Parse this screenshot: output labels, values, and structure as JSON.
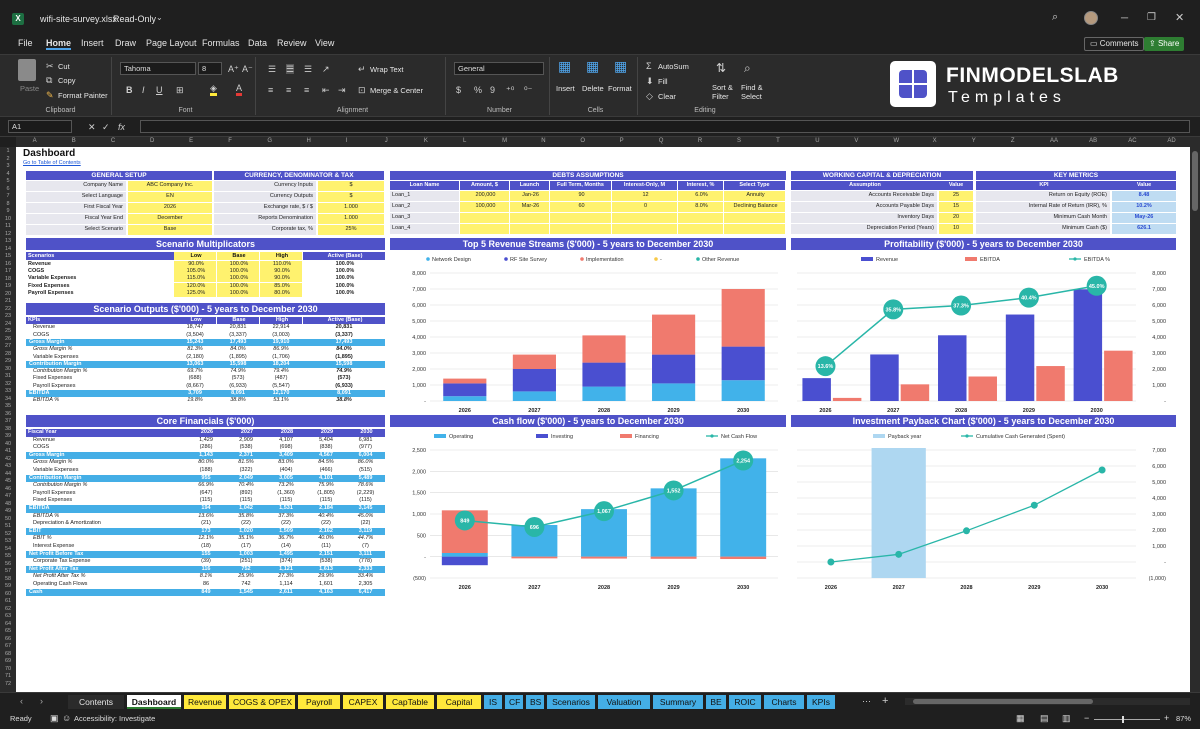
{
  "window": {
    "filename": "wifi-site-survey.xlsx",
    "mode": "Read-Only",
    "comments": "Comments",
    "share": "Share"
  },
  "menu": [
    "File",
    "Home",
    "Insert",
    "Draw",
    "Page Layout",
    "Formulas",
    "Data",
    "Review",
    "View"
  ],
  "ribbon": {
    "paste": "Paste",
    "cut": "Cut",
    "copy": "Copy",
    "format_painter": "Format Painter",
    "clipboard": "Clipboard",
    "font_name": "Tahoma",
    "font_size": "8",
    "font": "Font",
    "wrap_text": "Wrap Text",
    "merge_center": "Merge & Center",
    "alignment": "Alignment",
    "number_format": "General",
    "number": "Number",
    "insert": "Insert",
    "delete": "Delete",
    "format": "Format",
    "cells": "Cells",
    "autosum": "AutoSum",
    "fill": "Fill",
    "clear": "Clear",
    "sort_filter": "Sort & Filter",
    "find_select": "Find & Select",
    "editing": "Editing"
  },
  "logo": {
    "name": "FINMODELSLAB",
    "sub": "Templates"
  },
  "formula_bar": {
    "cell_ref": "A1",
    "fx": "fx"
  },
  "columns": [
    "A",
    "B",
    "C",
    "D",
    "E",
    "F",
    "G",
    "H",
    "I",
    "J",
    "K",
    "L",
    "M",
    "N",
    "O",
    "P",
    "Q",
    "R",
    "S",
    "T",
    "U",
    "V",
    "W",
    "X",
    "Y",
    "Z",
    "AA",
    "AB",
    "AC",
    "AD"
  ],
  "dashboard": {
    "title": "Dashboard",
    "toc_link": "Go to Table of Contents"
  },
  "general_setup": {
    "title": "GENERAL SETUP",
    "rows": [
      [
        "Company Name",
        "ABC Company Inc."
      ],
      [
        "Select Language",
        "EN"
      ],
      [
        "First Fiscal Year",
        "2026"
      ],
      [
        "Fiscal Year End",
        "December"
      ],
      [
        "Select Scenario",
        "Base"
      ]
    ]
  },
  "currency": {
    "title": "CURRENCY, DENOMINATOR & TAX",
    "rows": [
      [
        "Currency Inputs",
        "$"
      ],
      [
        "Currency Outputs",
        "$"
      ],
      [
        "Exchange rate, $ / $",
        "1.000"
      ],
      [
        "Reports Denomination",
        "1.000"
      ],
      [
        "Corporate tax, %",
        "25%"
      ]
    ]
  },
  "debts": {
    "title": "DEBTS ASSUMPTIONS",
    "headers": [
      "Loan Name",
      "Amount, $",
      "Launch",
      "Full Term, Months",
      "Interest-Only, M",
      "Interest, %",
      "Select Type"
    ],
    "rows": [
      [
        "Loan_1",
        "200,000",
        "Jan-26",
        "90",
        "12",
        "6.0%",
        "Annuity"
      ],
      [
        "Loan_2",
        "100,000",
        "Mar-26",
        "60",
        "0",
        "8.0%",
        "Declining Balance"
      ],
      [
        "Loan_3",
        "",
        "",
        "",
        "",
        "",
        ""
      ],
      [
        "Loan_4",
        "",
        "",
        "",
        "",
        "",
        ""
      ]
    ]
  },
  "working_capital": {
    "title": "WORKING CAPITAL & DEPRECIATION",
    "headers": [
      "Assumption",
      "Value"
    ],
    "rows": [
      [
        "Accounts Receivable Days",
        "25"
      ],
      [
        "Accounts Payable Days",
        "15"
      ],
      [
        "Inventory Days",
        "20"
      ],
      [
        "Depreciation Period (Years)",
        "10"
      ]
    ]
  },
  "key_metrics": {
    "title": "KEY METRICS",
    "headers": [
      "KPI",
      "Value"
    ],
    "rows": [
      [
        "Return on Equity (ROE)",
        "8.48"
      ],
      [
        "Internal Rate of Return (IRR), %",
        "10.2%"
      ],
      [
        "Minimum Cash Month",
        "May-26"
      ],
      [
        "Minimum Cash ($)",
        "626.1"
      ]
    ]
  },
  "scenario_mult": {
    "title": "Scenario Multiplicators",
    "headers": [
      "Scenarios",
      "Low",
      "Base",
      "High",
      "Active (Base)"
    ],
    "rows": [
      [
        "Revenue",
        "90.0%",
        "100.0%",
        "110.0%",
        "100.0%"
      ],
      [
        "COGS",
        "105.0%",
        "100.0%",
        "90.0%",
        "100.0%"
      ],
      [
        "Variable Expenses",
        "115.0%",
        "100.0%",
        "90.0%",
        "100.0%"
      ],
      [
        "Fixed Expenses",
        "120.0%",
        "100.0%",
        "85.0%",
        "100.0%"
      ],
      [
        "Payroll Expenses",
        "125.0%",
        "100.0%",
        "80.0%",
        "100.0%"
      ]
    ]
  },
  "scenario_out": {
    "title": "Scenario Outputs ($'000) - 5 years to December 2030",
    "headers": [
      "KPIs",
      "Low",
      "Base",
      "High",
      "Active (Base)"
    ],
    "rows": [
      [
        "Revenue",
        "18,747",
        "20,831",
        "22,914",
        "20,831",
        "n"
      ],
      [
        "COGS",
        "(3,504)",
        "(3,337)",
        "(3,003)",
        "(3,337)",
        "n"
      ],
      [
        "Gross Margin",
        "15,243",
        "17,493",
        "19,910",
        "17,493",
        "h"
      ],
      [
        "Gross Margin %",
        "81.3%",
        "84.0%",
        "86.9%",
        "84.0%",
        "i"
      ],
      [
        "Variable Expenses",
        "(2,180)",
        "(1,895)",
        "(1,706)",
        "(1,895)",
        "n"
      ],
      [
        "Contribution Margin",
        "13,063",
        "15,598",
        "18,204",
        "15,598",
        "h"
      ],
      [
        "Contribution Margin %",
        "69.7%",
        "74.9%",
        "79.4%",
        "74.9%",
        "i"
      ],
      [
        "Fixed Expenses",
        "(688)",
        "(573)",
        "(487)",
        "(573)",
        "n"
      ],
      [
        "Payroll Expenses",
        "(8,667)",
        "(6,933)",
        "(5,547)",
        "(6,933)",
        "n"
      ],
      [
        "EBITDA",
        "3,709",
        "8,091",
        "12,170",
        "8,091",
        "h"
      ],
      [
        "EBITDA %",
        "19.8%",
        "38.8%",
        "53.1%",
        "38.8%",
        "i"
      ]
    ]
  },
  "core": {
    "title": "Core Financials ($'000)",
    "headers": [
      "Fiscal Year",
      "2026",
      "2027",
      "2028",
      "2029",
      "2030"
    ],
    "rows": [
      [
        "Revenue",
        "1,429",
        "2,909",
        "4,107",
        "5,404",
        "6,981",
        "n"
      ],
      [
        "COGS",
        "(286)",
        "(538)",
        "(698)",
        "(838)",
        "(977)",
        "n"
      ],
      [
        "Gross Margin",
        "1,143",
        "2,371",
        "3,409",
        "4,567",
        "6,004",
        "h"
      ],
      [
        "Gross Margin %",
        "80.0%",
        "81.5%",
        "83.0%",
        "84.5%",
        "86.0%",
        "i"
      ],
      [
        "Variable Expenses",
        "(188)",
        "(322)",
        "(404)",
        "(466)",
        "(515)",
        "n"
      ],
      [
        "Contribution Margin",
        "955",
        "2,049",
        "3,005",
        "4,101",
        "5,489",
        "h"
      ],
      [
        "Contribution Margin %",
        "66.9%",
        "70.4%",
        "73.2%",
        "75.9%",
        "78.6%",
        "i"
      ],
      [
        "Payroll Expenses",
        "(647)",
        "(892)",
        "(1,360)",
        "(1,805)",
        "(2,229)",
        "n"
      ],
      [
        "Fixed Expenses",
        "(115)",
        "(115)",
        "(115)",
        "(115)",
        "(115)",
        "n"
      ],
      [
        "EBITDA",
        "194",
        "1,042",
        "1,531",
        "2,184",
        "3,145",
        "h"
      ],
      [
        "EBITDA %",
        "13.6%",
        "35.8%",
        "37.3%",
        "40.4%",
        "45.0%",
        "i"
      ],
      [
        "Depreciation & Amortization",
        "(21)",
        "(22)",
        "(22)",
        "(22)",
        "(22)",
        "n"
      ],
      [
        "EBIT",
        "173",
        "1,020",
        "1,509",
        "2,162",
        "3,119",
        "h"
      ],
      [
        "EBIT %",
        "12.1%",
        "35.1%",
        "36.7%",
        "40.0%",
        "44.7%",
        "i"
      ],
      [
        "Interest Expense",
        "(18)",
        "(17)",
        "(14)",
        "(11)",
        "(7)",
        "n"
      ],
      [
        "Net Profit Before Tax",
        "155",
        "1,003",
        "1,495",
        "2,151",
        "3,111",
        "h"
      ],
      [
        "Corporate Tax Expense",
        "(39)",
        "(251)",
        "(374)",
        "(538)",
        "(778)",
        "n"
      ],
      [
        "Net Profit After Tax",
        "116",
        "752",
        "1,121",
        "1,613",
        "2,333",
        "h"
      ],
      [
        "Net Profit After Tax %",
        "8.1%",
        "25.9%",
        "27.3%",
        "29.9%",
        "33.4%",
        "i"
      ],
      [
        "Operating Cash Flows",
        "86",
        "742",
        "1,114",
        "1,601",
        "2,305",
        "n"
      ],
      [
        "Cash",
        "849",
        "1,545",
        "2,611",
        "4,163",
        "6,417",
        "h"
      ]
    ]
  },
  "charts": {
    "years": [
      "2026",
      "2027",
      "2028",
      "2029",
      "2030"
    ],
    "revenue_streams": {
      "title": "Top 5 Revenue Streams ($'000) - 5 years to December 2030",
      "legend": [
        "Network Design",
        "RF Site Survey",
        "Implementation",
        "-",
        "Other Revenue"
      ],
      "colors": [
        "#41b2ea",
        "#4a4fd0",
        "#f07a6e",
        "#f7c948",
        "#29b6a8"
      ],
      "yticks": [
        "-",
        "1,000",
        "2,000",
        "3,000",
        "4,000",
        "5,000",
        "6,000",
        "7,000",
        "8,000"
      ],
      "ymax": 8000,
      "stacks": [
        [
          300,
          800,
          300,
          0,
          0
        ],
        [
          600,
          1400,
          900,
          0,
          0
        ],
        [
          900,
          1500,
          1700,
          0,
          0
        ],
        [
          1100,
          1800,
          2500,
          0,
          0
        ],
        [
          1300,
          2100,
          3600,
          0,
          0
        ]
      ]
    },
    "profitability": {
      "title": "Profitability ($'000) - 5 years to December 2030",
      "legend": [
        "Revenue",
        "EBITDA",
        "EBITDA %"
      ],
      "yticks_left": [
        "-",
        "1,000",
        "2,000",
        "3,000",
        "4,000",
        "5,000",
        "6,000",
        "7,000",
        "8,000"
      ],
      "ymax": 8000,
      "revenue": [
        1429,
        2909,
        4107,
        5404,
        6981
      ],
      "ebitda": [
        194,
        1042,
        1531,
        2184,
        3145
      ],
      "pct": [
        13.6,
        35.8,
        37.3,
        40.4,
        45.0
      ],
      "pct_labels": [
        "13.6%",
        "35.8%",
        "37.3%",
        "40.4%",
        "45.0%"
      ]
    },
    "cashflow": {
      "title": "Cash flow ($'000) - 5 years to December 2030",
      "legend": [
        "Operating",
        "Investing",
        "Financing",
        "Net Cash Flow"
      ],
      "yticks": [
        "(500)",
        "-",
        "500",
        "1,000",
        "1,500",
        "2,000",
        "2,500"
      ],
      "ymin": -500,
      "ymax": 2500,
      "operating": [
        86,
        742,
        1114,
        1601,
        2305
      ],
      "investing": [
        -200,
        0,
        0,
        0,
        0
      ],
      "financing": [
        1000,
        -40,
        -45,
        -50,
        -55
      ],
      "net": [
        849,
        696,
        1067,
        1552,
        2254
      ],
      "net_labels": [
        "849",
        "696",
        "1,067",
        "1,552",
        "2,254"
      ]
    },
    "payback": {
      "title": "Investment Payback Chart ($'000) - 5 years to December 2030",
      "legend": [
        "Payback year",
        "Cumulative Cash Generated (Spent)"
      ],
      "yticks": [
        "(1,000)",
        "-",
        "1,000",
        "2,000",
        "3,000",
        "4,000",
        "5,000",
        "6,000",
        "7,000"
      ],
      "ymin": -1000,
      "ymax": 7000,
      "cumulative": [
        0,
        480,
        1950,
        3550,
        5750
      ],
      "payback_year": "2027"
    }
  },
  "tabs": [
    [
      "Contents",
      "#2b2b2b"
    ],
    [
      "Dashboard",
      "#ffffff"
    ],
    [
      "Revenue",
      "#ffe93b"
    ],
    [
      "COGS & OPEX",
      "#ffe93b"
    ],
    [
      "Payroll",
      "#ffe93b"
    ],
    [
      "CAPEX",
      "#ffe93b"
    ],
    [
      "CapTable",
      "#ffe93b"
    ],
    [
      "Capital",
      "#ffe93b"
    ],
    [
      "IS",
      "#44aee6"
    ],
    [
      "CF",
      "#44aee6"
    ],
    [
      "BS",
      "#44aee6"
    ],
    [
      "Scenarios",
      "#44aee6"
    ],
    [
      "Valuation",
      "#44aee6"
    ],
    [
      "Summary",
      "#44aee6"
    ],
    [
      "BE",
      "#44aee6"
    ],
    [
      "ROIC",
      "#44aee6"
    ],
    [
      "Charts",
      "#44aee6"
    ],
    [
      "KPIs",
      "#44aee6"
    ]
  ],
  "status": {
    "ready": "Ready",
    "accessibility": "Accessibility: Investigate",
    "zoom": "87%"
  }
}
